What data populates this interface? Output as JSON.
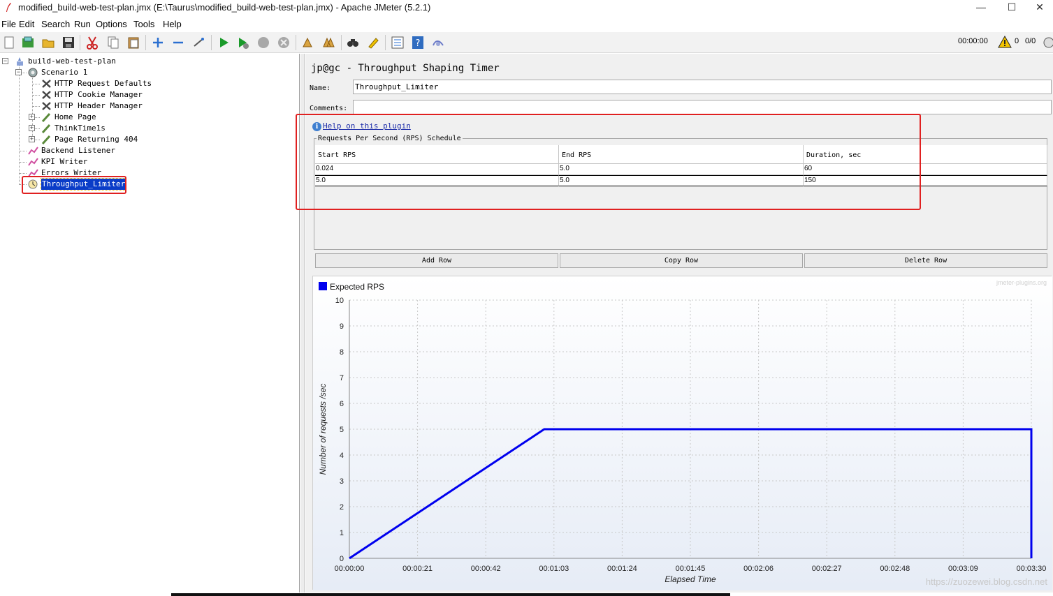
{
  "window": {
    "title": "modified_build-web-test-plan.jmx (E:\\Taurus\\modified_build-web-test-plan.jmx) - Apache JMeter (5.2.1)",
    "minimize": "—",
    "maximize": "☐",
    "close": "✕"
  },
  "menu": [
    "File",
    "Edit",
    "Search",
    "Run",
    "Options",
    "Tools",
    "Help"
  ],
  "toolbar": {
    "elapsed": "00:00:00",
    "warnings": "0",
    "threads": "0/0"
  },
  "tree": [
    {
      "label": "build-web-test-plan",
      "icon": "test-plan-icon"
    },
    {
      "label": "Scenario 1",
      "icon": "thread-group-icon"
    },
    {
      "label": "HTTP Request Defaults",
      "icon": "config-element-icon"
    },
    {
      "label": "HTTP Cookie Manager",
      "icon": "config-element-icon"
    },
    {
      "label": "HTTP Header Manager",
      "icon": "config-element-icon"
    },
    {
      "label": "Home Page",
      "icon": "sampler-icon"
    },
    {
      "label": "ThinkTime1s",
      "icon": "sampler-icon"
    },
    {
      "label": "Page Returning 404",
      "icon": "sampler-icon"
    },
    {
      "label": "Backend Listener",
      "icon": "listener-icon"
    },
    {
      "label": "KPI Writer",
      "icon": "listener-icon"
    },
    {
      "label": "Errors Writer",
      "icon": "listener-icon"
    },
    {
      "label": "Throughput_Limiter",
      "icon": "timer-icon",
      "selected": true
    }
  ],
  "panel": {
    "title": "jp@gc - Throughput Shaping Timer",
    "name_label": "Name:",
    "name_value": "Throughput_Limiter",
    "comments_label": "Comments:",
    "comments_value": "",
    "help_link": "Help on this plugin",
    "schedule_title": "Requests Per Second (RPS) Schedule",
    "columns": [
      "Start RPS",
      "End RPS",
      "Duration, sec"
    ],
    "rows": [
      [
        "0.024",
        "5.0",
        "60"
      ],
      [
        "5.0",
        "5.0",
        "150"
      ]
    ],
    "buttons": [
      "Add Row",
      "Copy Row",
      "Delete Row"
    ]
  },
  "chart_data": {
    "type": "line",
    "title": "",
    "xlabel": "Elapsed Time",
    "ylabel": "Number of requests /sec",
    "ylim": [
      0,
      10
    ],
    "yticks": [
      0,
      1,
      2,
      3,
      4,
      5,
      6,
      7,
      8,
      9,
      10
    ],
    "xlim_seconds": [
      0,
      210
    ],
    "xticks": [
      "00:00:00",
      "00:00:21",
      "00:00:42",
      "00:01:03",
      "00:01:24",
      "00:01:45",
      "00:02:06",
      "00:02:27",
      "00:02:48",
      "00:03:09",
      "00:03:30"
    ],
    "grid": true,
    "legend": "top-left",
    "series": [
      {
        "name": "Expected RPS",
        "color": "#0000ee",
        "x": [
          0,
          60,
          210,
          210
        ],
        "y": [
          0,
          5,
          5,
          0
        ]
      }
    ],
    "watermark": "jmeter-plugins.org"
  },
  "page_watermark": "https://zuozewei.blog.csdn.net"
}
